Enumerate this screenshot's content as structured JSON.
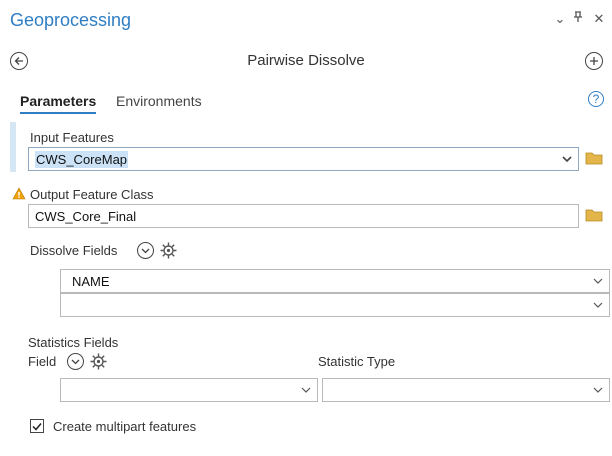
{
  "pane": {
    "title": "Geoprocessing",
    "tool_title": "Pairwise Dissolve"
  },
  "tabs": [
    {
      "label": "Parameters",
      "active": true
    },
    {
      "label": "Environments",
      "active": false
    }
  ],
  "help_glyph": "?",
  "input_features": {
    "label": "Input Features",
    "value": "CWS_CoreMap"
  },
  "output_feature_class": {
    "label": "Output Feature Class",
    "value": "CWS_Core_Final",
    "warning": true
  },
  "dissolve_fields": {
    "label": "Dissolve Fields",
    "rows": [
      "NAME",
      ""
    ]
  },
  "statistics_fields": {
    "label": "Statistics Fields",
    "field_label": "Field",
    "statistic_type_label": "Statistic Type",
    "field_value": "",
    "statistic_type_value": ""
  },
  "create_multipart": {
    "label": "Create multipart features",
    "checked": true
  },
  "colors": {
    "accent": "#2f7ec4",
    "selection": "#cce3f7",
    "folder": "#e3b54a",
    "warning": "#f0a30a"
  }
}
